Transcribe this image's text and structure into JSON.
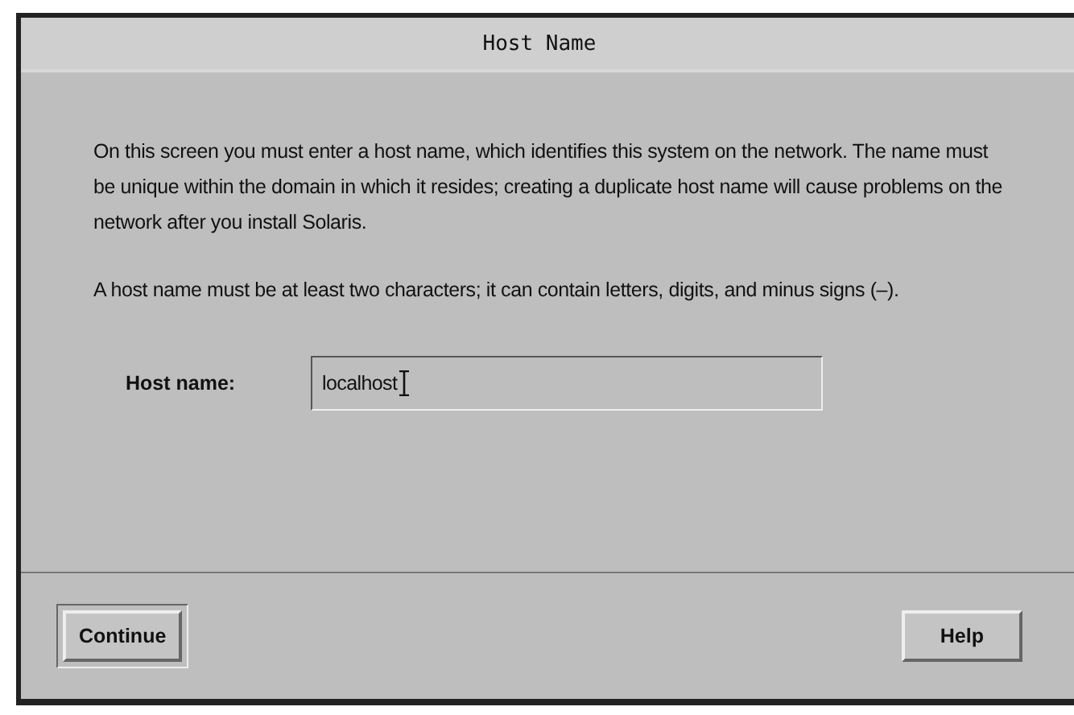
{
  "window": {
    "title": "Host Name"
  },
  "paragraphs": [
    "On this screen you must enter a host name, which identifies this system on the network.  The name must be unique within the domain in which it resides; creating a duplicate host name will cause problems on the network after you install Solaris.",
    "A host name must be at least two characters; it can contain letters, digits, and minus signs (–)."
  ],
  "field": {
    "label": "Host name:",
    "value": "localhost"
  },
  "buttons": [
    {
      "label": "Continue",
      "default": true
    },
    {
      "label": "Help",
      "default": false
    }
  ]
}
